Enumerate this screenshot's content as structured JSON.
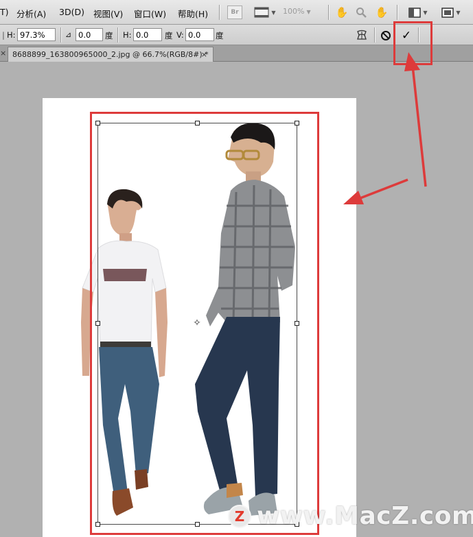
{
  "menu": {
    "items": [
      "T)",
      "分析(A)",
      "3D(D)",
      "视图(V)",
      "窗口(W)",
      "帮助(H)"
    ],
    "bridge_label": "Br",
    "zoom_value": "100%"
  },
  "options": {
    "h_label": "H:",
    "h_scale_value": "97.3%",
    "angle_value": "0.0",
    "degree_unit": "度",
    "h_skew_label": "H:",
    "h_skew_value": "0.0",
    "v_skew_label": "V:",
    "v_skew_value": "0.0"
  },
  "document": {
    "tab_title": "8688899_163800965000_2.jpg @ 66.7%(RGB/8#) *",
    "close_glyph": "×"
  },
  "watermark": {
    "logo_letter": "Z",
    "text": "www.MacZ.com"
  },
  "colors": {
    "annotation_red": "#dd3b3b",
    "workspace_gray": "#b1b1b1"
  },
  "icons": [
    "mini-bridge-icon",
    "film-strip-icon",
    "hand-icon",
    "zoom-icon",
    "rotate-view-icon",
    "arrange-documents-icon",
    "screen-mode-icon",
    "angle-icon",
    "warp-icon",
    "cancel-transform-icon",
    "commit-transform-icon"
  ]
}
